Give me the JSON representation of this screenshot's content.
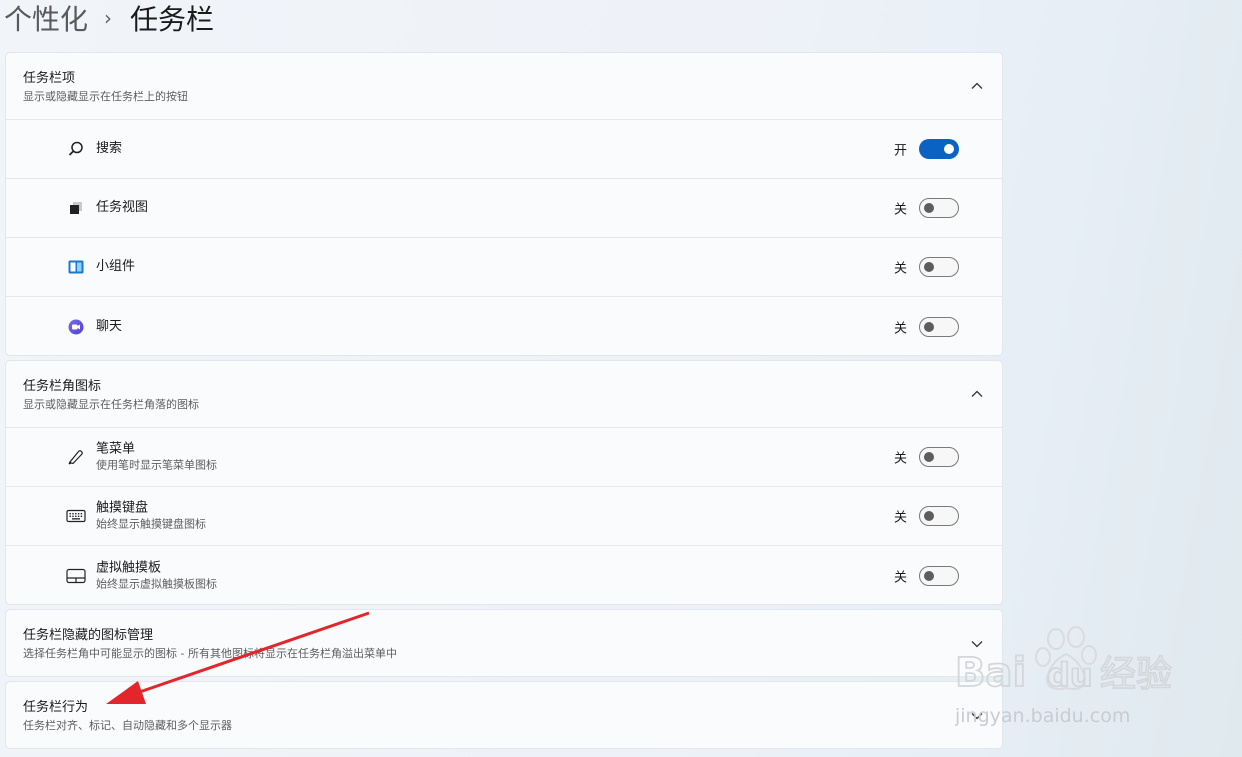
{
  "breadcrumb": {
    "parent": "个性化",
    "separator": "›",
    "current": "任务栏"
  },
  "taskbar_items": {
    "title": "任务栏项",
    "subtitle": "显示或隐藏显示在任务栏上的按钮",
    "items": [
      {
        "label": "搜索",
        "state": "开",
        "on": true,
        "icon": "search-icon"
      },
      {
        "label": "任务视图",
        "state": "关",
        "on": false,
        "icon": "task-view-icon"
      },
      {
        "label": "小组件",
        "state": "关",
        "on": false,
        "icon": "widgets-icon"
      },
      {
        "label": "聊天",
        "state": "关",
        "on": false,
        "icon": "chat-icon"
      }
    ]
  },
  "corner_icons": {
    "title": "任务栏角图标",
    "subtitle": "显示或隐藏显示在任务栏角落的图标",
    "items": [
      {
        "label": "笔菜单",
        "sub": "使用笔时显示笔菜单图标",
        "state": "关",
        "on": false,
        "icon": "pen-icon"
      },
      {
        "label": "触摸键盘",
        "sub": "始终显示触摸键盘图标",
        "state": "关",
        "on": false,
        "icon": "keyboard-icon"
      },
      {
        "label": "虚拟触摸板",
        "sub": "始终显示虚拟触摸板图标",
        "state": "关",
        "on": false,
        "icon": "touchpad-icon"
      }
    ]
  },
  "hidden_icons": {
    "title": "任务栏隐藏的图标管理",
    "subtitle": "选择任务栏角中可能显示的图标 - 所有其他图标将显示在任务栏角溢出菜单中"
  },
  "behaviors": {
    "title": "任务栏行为",
    "subtitle": "任务栏对齐、标记、自动隐藏和多个显示器"
  },
  "watermark": {
    "brand": "Bai",
    "brand2": "du",
    "cn": "经验",
    "url": "jingyan.baidu.com"
  },
  "colors": {
    "accent": "#0a63c4",
    "arrow": "#e2262b"
  }
}
